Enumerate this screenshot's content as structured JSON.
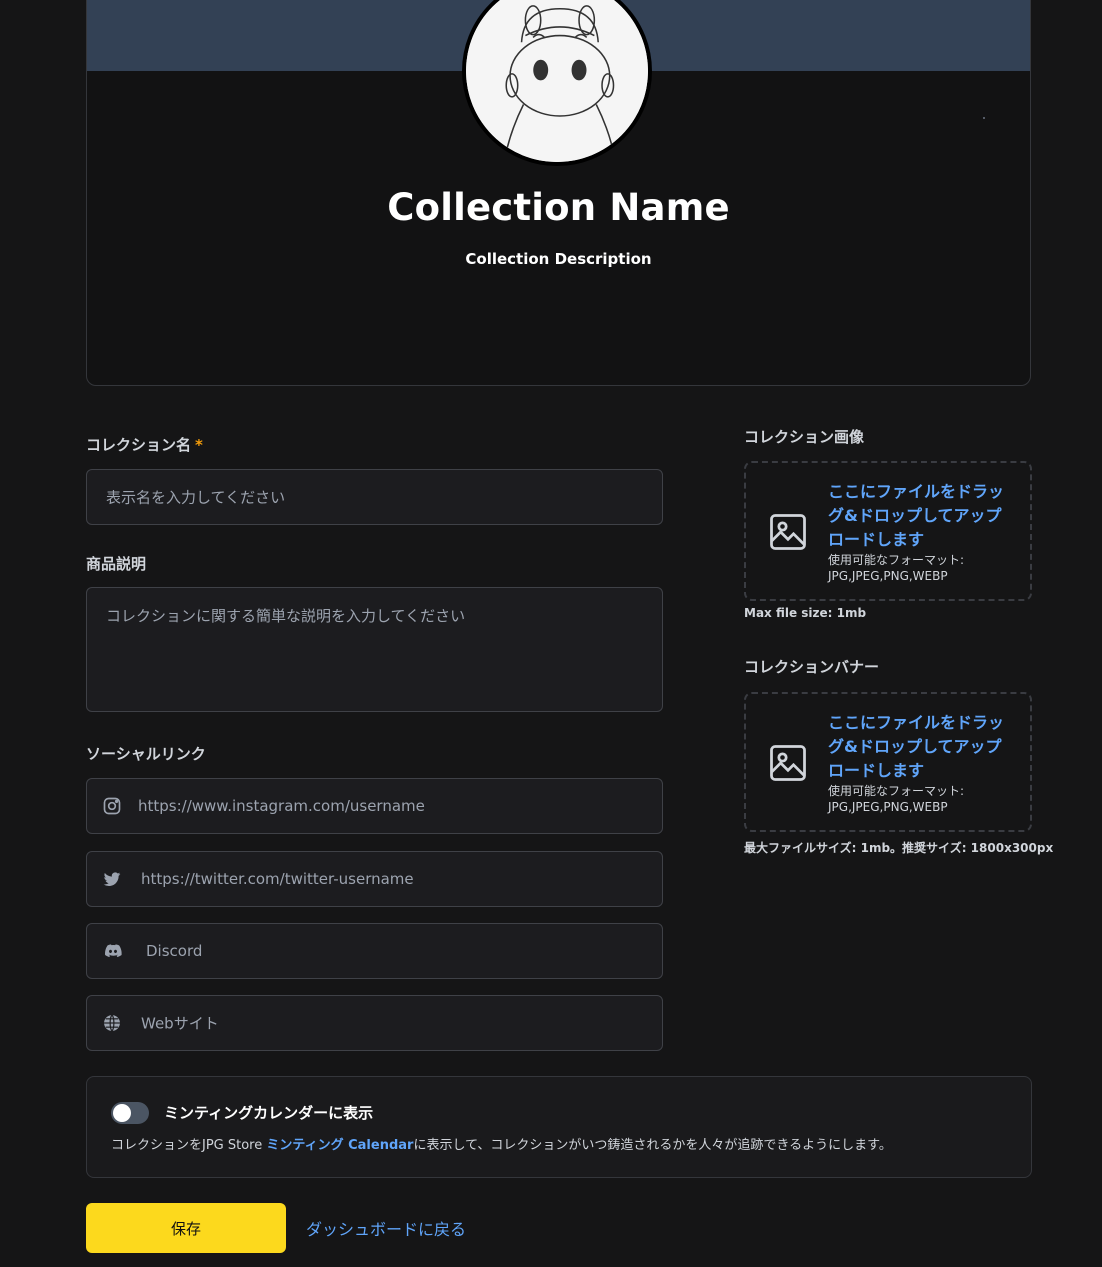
{
  "preview": {
    "collection_name": "Collection Name",
    "collection_description": "Collection Description"
  },
  "form": {
    "name_label": "コレクション名",
    "name_required": "*",
    "name_placeholder": "表示名を入力してください",
    "description_label": "商品説明",
    "description_placeholder": "コレクションに関する簡単な説明を入力してください",
    "social_label": "ソーシャルリンク",
    "social": {
      "instagram_placeholder": "https://www.instagram.com/username",
      "twitter_placeholder": "https://twitter.com/twitter-username",
      "discord_placeholder": "Discord",
      "website_placeholder": "Webサイト"
    }
  },
  "uploads": {
    "image_label": "コレクション画像",
    "image_cta": "ここにファイルをドラッグ&ドロップしてアップロードします",
    "image_formats_label": "使用可能なフォーマット:",
    "image_formats": "JPG,JPEG,PNG,WEBP",
    "image_note": "Max file size: 1mb",
    "banner_label": "コレクションバナー",
    "banner_cta": "ここにファイルをドラッグ&ドロップしてアップロードします",
    "banner_formats_label": "使用可能なフォーマット:",
    "banner_formats": "JPG,JPEG,PNG,WEBP",
    "banner_note": "最大ファイルサイズ: 1mb。推奨サイズ: 1800x300px"
  },
  "calendar": {
    "title": "ミンティングカレンダーに表示",
    "desc_prefix": "コレクションをJPG Store ",
    "desc_link": "ミンティング Calendar",
    "desc_suffix": "に表示して、コレクションがいつ鋳造されるかを人々が追跡できるようにします。",
    "enabled": false
  },
  "actions": {
    "save_label": "保存",
    "back_label": "ダッシュボードに戻る"
  },
  "colors": {
    "background": "#151516",
    "banner": "#334155",
    "accent_yellow": "#fcd91d",
    "link_blue": "#60a5fa",
    "required_orange": "#f59e0b"
  },
  "icons": [
    "image-icon",
    "instagram-icon",
    "twitter-icon",
    "discord-icon",
    "globe-icon"
  ]
}
